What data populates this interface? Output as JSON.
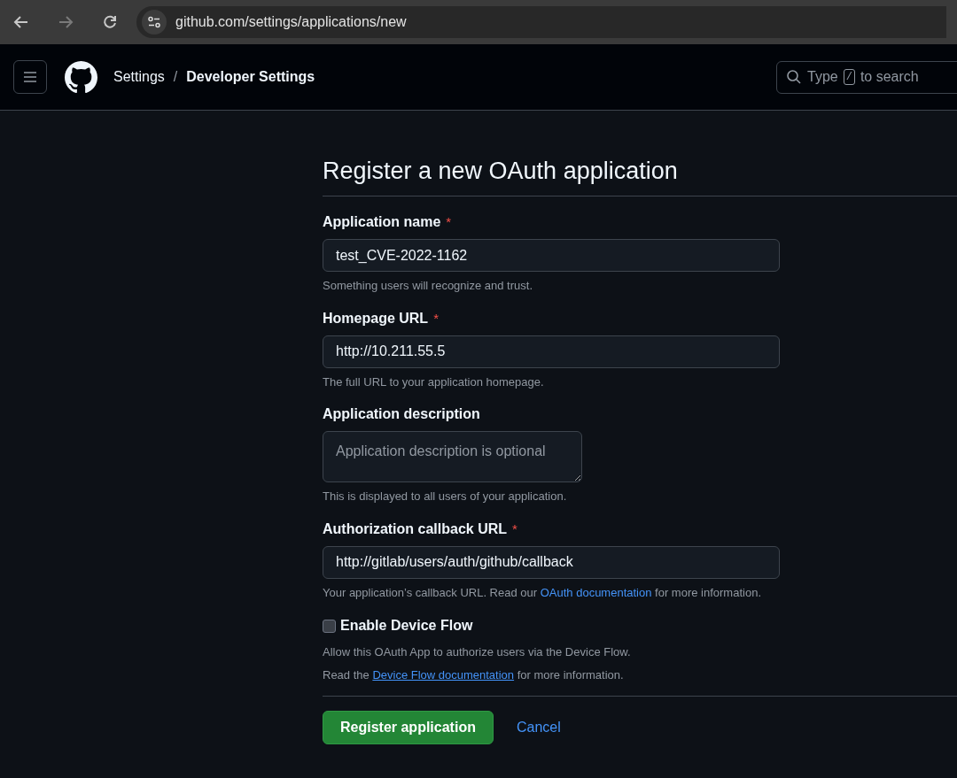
{
  "browser": {
    "url": "github.com/settings/applications/new"
  },
  "header": {
    "breadcrumb": [
      {
        "label": "Settings",
        "current": false
      },
      {
        "label": "Developer Settings",
        "current": true
      }
    ],
    "breadcrumb_separator": "/",
    "search": {
      "before_key": "Type",
      "key": "/",
      "after_key": "to search"
    }
  },
  "form": {
    "title": "Register a new OAuth application",
    "fields": [
      {
        "kind": "text",
        "label": "Application name",
        "required_mark": "*",
        "value": "test_CVE-2022-1162",
        "help": {
          "before": "Something users will recognize and trust."
        }
      },
      {
        "kind": "text",
        "label": "Homepage URL",
        "required_mark": "*",
        "value": "http://10.211.55.5",
        "help": {
          "before": "The full URL to your application homepage."
        }
      },
      {
        "kind": "textarea",
        "label": "Application description",
        "placeholder": "Application description is optional",
        "help": {
          "before": "This is displayed to all users of your application."
        }
      },
      {
        "kind": "text",
        "label": "Authorization callback URL",
        "required_mark": "*",
        "value": "http://gitlab/users/auth/github/callback",
        "help": {
          "before": "Your application’s callback URL. Read our ",
          "link": "OAuth documentation",
          "after": " for more information."
        }
      }
    ],
    "device_flow": {
      "label": "Enable Device Flow",
      "checked": false,
      "note": "Allow this OAuth App to authorize users via the Device Flow.",
      "read": {
        "before": "Read the ",
        "link": "Device Flow documentation",
        "after": " for more information."
      }
    },
    "buttons": [
      {
        "kind": "primary",
        "label": "Register application"
      },
      {
        "kind": "link",
        "label": "Cancel"
      }
    ]
  }
}
